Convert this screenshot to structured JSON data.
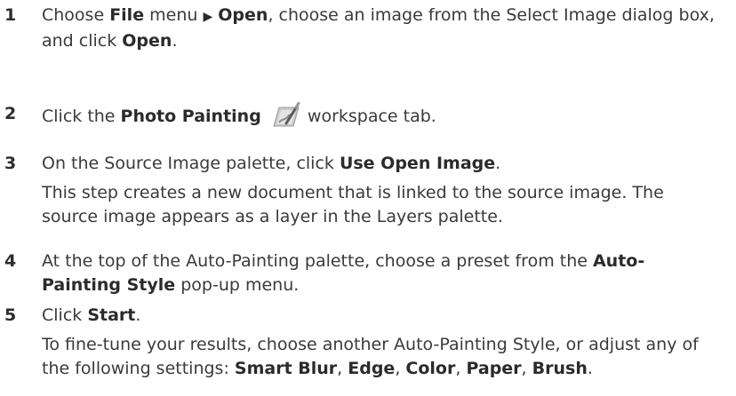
{
  "steps": [
    {
      "num": "1",
      "pre1": "Choose ",
      "b1": "File",
      "mid1": " menu ",
      "arrow": "▶",
      "b2": "Open",
      "mid2": ", choose an image from the Select Image dialog box, and click ",
      "b3": "Open",
      "post": "."
    },
    {
      "num": "2",
      "pre": "Click the ",
      "b1": "Photo Painting",
      "post": " workspace tab.",
      "icon": "photo-painting-icon"
    },
    {
      "num": "3",
      "pre": "On the Source Image palette, click ",
      "b1": "Use Open Image",
      "post": ".",
      "note": "This step creates a new document that is linked to the source image. The source image appears as a layer in the Layers palette."
    },
    {
      "num": "4",
      "pre": "At the top of the Auto-Painting palette, choose a preset from the ",
      "b1": "Auto-Painting Style",
      "post": " pop-up menu."
    },
    {
      "num": "5",
      "pre": "Click ",
      "b1": "Start",
      "post": ".",
      "note_pre": "To fine-tune your results, choose another Auto-Painting Style, or adjust any of the following settings: ",
      "s1": "Smart Blur",
      "sep1": ", ",
      "s2": "Edge",
      "sep2": ", ",
      "s3": "Color",
      "sep3": ", ",
      "s4": "Paper",
      "sep4": ", ",
      "s5": "Brush",
      "note_post": "."
    }
  ]
}
